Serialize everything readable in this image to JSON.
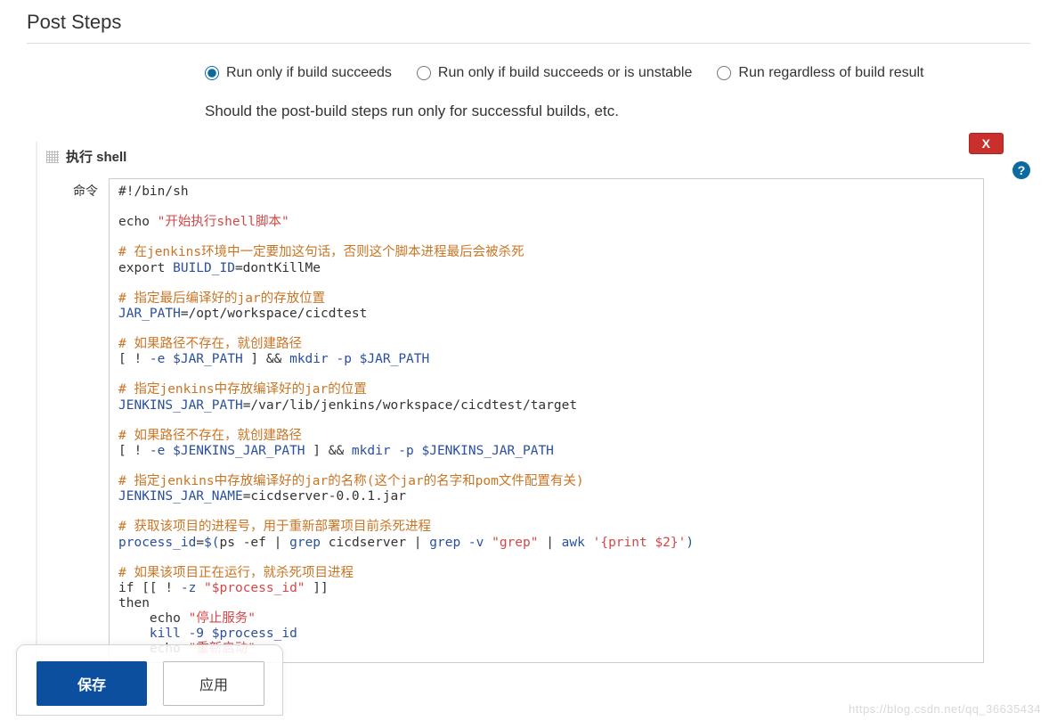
{
  "section": {
    "title": "Post Steps"
  },
  "radios": {
    "opt1": "Run only if build succeeds",
    "opt2": "Run only if build succeeds or is unstable",
    "opt3": "Run regardless of build result",
    "selected": "opt1"
  },
  "help_text": "Should the post-build steps run only for successful builds, etc.",
  "step": {
    "title": "执行 shell",
    "field_label": "命令",
    "close_label": "X",
    "help_symbol": "?"
  },
  "shell": {
    "l01a": "#!/bin/sh",
    "l02a": "echo ",
    "l02b": "\"开始执行shell脚本\"",
    "l03a": "# 在jenkins环境中一定要加这句话，否则这个脚本进程最后会被杀死",
    "l04a": "export ",
    "l04b": "BUILD_ID",
    "l04c": "=dontKillMe",
    "l05a": "# 指定最后编译好的jar的存放位置",
    "l06a": "JAR_PATH",
    "l06b": "=/opt/workspace/cicdtest",
    "l07a": "# 如果路径不存在，就创建路径",
    "l08a": "[ ! ",
    "l08b": "-e",
    "l08c": " $JAR_PATH",
    "l08d": " ] && ",
    "l08e": "mkdir -p",
    "l08f": " $JAR_PATH",
    "l09a": "# 指定jenkins中存放编译好的jar的位置",
    "l10a": "JENKINS_JAR_PATH",
    "l10b": "=/var/lib/jenkins/workspace/cicdtest/target",
    "l11a": "# 如果路径不存在，就创建路径",
    "l12a": "[ ! ",
    "l12b": "-e",
    "l12c": " $JENKINS_JAR_PATH",
    "l12d": " ] && ",
    "l12e": "mkdir -p",
    "l12f": " $JENKINS_JAR_PATH",
    "l13a": "# 指定jenkins中存放编译好的jar的名称(这个jar的名字和pom文件配置有关)",
    "l14a": "JENKINS_JAR_NAME",
    "l14b": "=cicdserver-0.0.1.jar",
    "l15a": "# 获取该项目的进程号，用于重新部署项目前杀死进程",
    "l16a": "process_id",
    "l16b": "=",
    "l16c": "$(",
    "l16d": "ps -ef",
    "l16e": " | ",
    "l16f": "grep",
    "l16g": " cicdserver | ",
    "l16h": "grep -v",
    "l16i": " \"grep\"",
    "l16j": " | ",
    "l16k": "awk",
    "l16l": " '{print $2}'",
    "l16m": ")",
    "l17a": "# 如果该项目正在运行，就杀死项目进程",
    "l18a": "if [[ ! ",
    "l18b": "-z",
    "l18c": " \"$process_id\"",
    "l18d": " ]]",
    "l19a": "then",
    "l20a": "    echo ",
    "l20b": "\"停止服务\"",
    "l21a": "    kill -9 ",
    "l21b": "$process_id",
    "l22a": "    echo ",
    "l22b": "\"重新启动\""
  },
  "buttons": {
    "save": "保存",
    "apply": "应用"
  },
  "watermark": "https://blog.csdn.net/qq_36635434"
}
